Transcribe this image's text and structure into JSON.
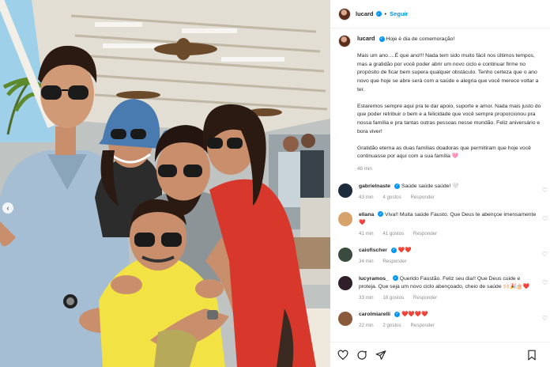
{
  "post": {
    "username": "lucard",
    "follow_label": "Seguir",
    "caption_lines": [
      "Hoje é dia de comemoração!",
      "Mais um ano….É que ano!!! Nada tem sido muito fácil nos últimos tempos, mas a gratidão por você poder abrir um novo ciclo e continuar firme no propósito de ficar bem supera qualquer obstáculo. Tenho certeza que o ano novo que hoje se abre será com a saúde e alegria que você merece voltar a ter.",
      "Estaremos sempre aqui pra te dar apoio, suporte e amor. Nada mais justo do que poder retribuir o bem e a felicidade que você sempre proporcionou pra nossa família e pra tantas outras pessoas nesse mundão. Feliz aniversário e bora viver!",
      "Gratidão eterna as duas famílias doadoras que permitiram que hoje você continuasse por aqui com a sua família 🩷"
    ],
    "time": "48 min"
  },
  "comments": [
    {
      "name": "gabrielnaste",
      "text": "Saúde saúde saúde! 🤍",
      "time": "43 min",
      "likes": "4 gostos",
      "reply": "Responder",
      "avatar_color": "#1d2b3a"
    },
    {
      "name": "eliana",
      "text": "Viva!! Muita saúde Fausto. Que Deus te abençoe imensamente ❤️",
      "time": "41 min",
      "likes": "41 gostos",
      "reply": "Responder",
      "avatar_color": "#d8a36b"
    },
    {
      "name": "caiofischer",
      "text": "❤️❤️",
      "time": "34 min",
      "likes": "",
      "reply": "Responder",
      "avatar_color": "#3b4a3f"
    },
    {
      "name": "lucyramos_",
      "text": "Querido Faustão. Feliz seu dia!! Que Deus cuide e proteja. Que seja um novo ciclo abençoado, cheio de saúde 🙌🏻🎉🎂❤️",
      "time": "33 min",
      "likes": "18 gostos",
      "reply": "Responder",
      "avatar_color": "#2e1f2a"
    },
    {
      "name": "carolmiarelli",
      "text": "❤️❤️❤️❤️",
      "time": "22 min",
      "likes": "2 gostos",
      "reply": "Responder",
      "avatar_color": "#8a5a3c"
    }
  ],
  "icons": {
    "like": "heart-icon",
    "comment": "comment-icon",
    "share": "share-icon",
    "save": "bookmark-icon",
    "carousel": "chevron-left-icon"
  },
  "colors": {
    "accent": "#0095f6",
    "verified": "#0095f6",
    "heart": "#ed4956",
    "muted": "#8e8e8e"
  }
}
